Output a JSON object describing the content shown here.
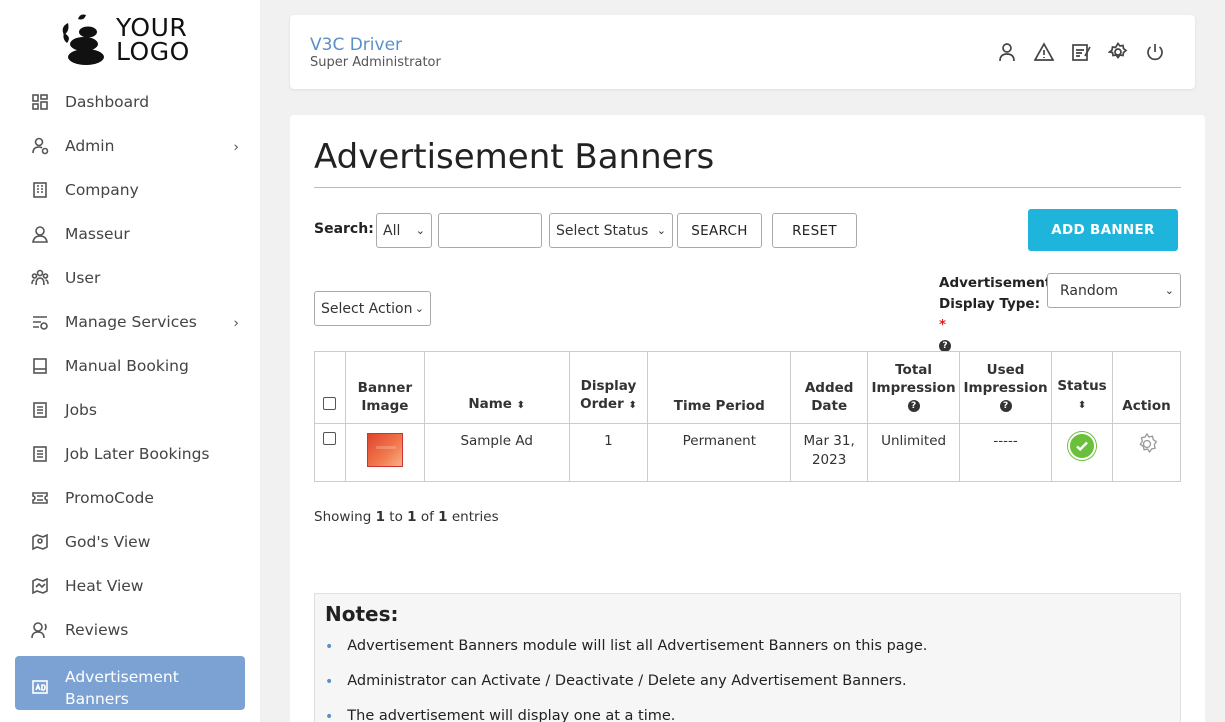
{
  "logo": {
    "text": "YOUR\nLOGO"
  },
  "sidebar": {
    "items": [
      {
        "label": "Dashboard",
        "icon": "dashboard-icon",
        "has_submenu": false
      },
      {
        "label": "Admin",
        "icon": "admin-icon",
        "has_submenu": true
      },
      {
        "label": "Company",
        "icon": "company-icon",
        "has_submenu": false
      },
      {
        "label": "Masseur",
        "icon": "masseur-icon",
        "has_submenu": false
      },
      {
        "label": "User",
        "icon": "users-icon",
        "has_submenu": false
      },
      {
        "label": "Manage Services",
        "icon": "services-icon",
        "has_submenu": true
      },
      {
        "label": "Manual Booking",
        "icon": "booking-icon",
        "has_submenu": false
      },
      {
        "label": "Jobs",
        "icon": "jobs-icon",
        "has_submenu": false
      },
      {
        "label": "Job Later Bookings",
        "icon": "later-bookings-icon",
        "has_submenu": false
      },
      {
        "label": "PromoCode",
        "icon": "promo-icon",
        "has_submenu": false
      },
      {
        "label": "God's View",
        "icon": "map-pin-icon",
        "has_submenu": false
      },
      {
        "label": "Heat View",
        "icon": "heat-map-icon",
        "has_submenu": false
      },
      {
        "label": "Reviews",
        "icon": "reviews-icon",
        "has_submenu": false
      },
      {
        "label": "Advertisement Banners",
        "icon": "ad-icon",
        "has_submenu": false,
        "active": true
      }
    ],
    "chevron": "›"
  },
  "header": {
    "app_name": "V3C Driver",
    "role": "Super Administrator",
    "tools": [
      "profile-icon",
      "alert-icon",
      "notes-icon",
      "settings-icon",
      "power-icon"
    ]
  },
  "page": {
    "title": "Advertisement Banners"
  },
  "filters": {
    "search_label": "Search:",
    "search_scope": "All",
    "search_value": "",
    "status_select": "Select Status",
    "search_button": "SEARCH",
    "reset_button": "RESET",
    "add_button": "ADD BANNER",
    "action_select": "Select Action",
    "display_type_label_line1": "Advertisement",
    "display_type_label_line2": "Display Type:",
    "display_type_required": "*",
    "display_type_value": "Random",
    "help_glyph": "?"
  },
  "table": {
    "headers": {
      "banner_image": [
        "Banner",
        "Image"
      ],
      "name": "Name",
      "display_order": [
        "Display",
        "Order"
      ],
      "time_period": "Time Period",
      "added_date": [
        "Added",
        "Date"
      ],
      "total_impression": [
        "Total",
        "Impression"
      ],
      "used_impression": [
        "Used",
        "Impression"
      ],
      "status": "Status",
      "action": "Action"
    },
    "rows": [
      {
        "name": "Sample Ad",
        "display_order": "1",
        "time_period": "Permanent",
        "added_date_line1": "Mar 31,",
        "added_date_line2": "2023",
        "total_impression": "Unlimited",
        "used_impression": "-----",
        "status": "active"
      }
    ],
    "sort_glyph": "⬍"
  },
  "pagination": {
    "prefix": "Showing ",
    "from": "1",
    "to_word": " to ",
    "to": "1",
    "of_word": " of ",
    "total": "1",
    "suffix": " entries"
  },
  "notes": {
    "title": "Notes:",
    "items": [
      "Advertisement Banners module will list all Advertisement Banners on this page.",
      "Administrator can Activate / Deactivate / Delete any Advertisement Banners.",
      "The advertisement will display one at a time."
    ]
  },
  "colors": {
    "accent": "#5b8fc8",
    "active_nav": "#7ba2d2",
    "primary_button": "#1eb4dc",
    "status_active": "#6cbf3a"
  }
}
